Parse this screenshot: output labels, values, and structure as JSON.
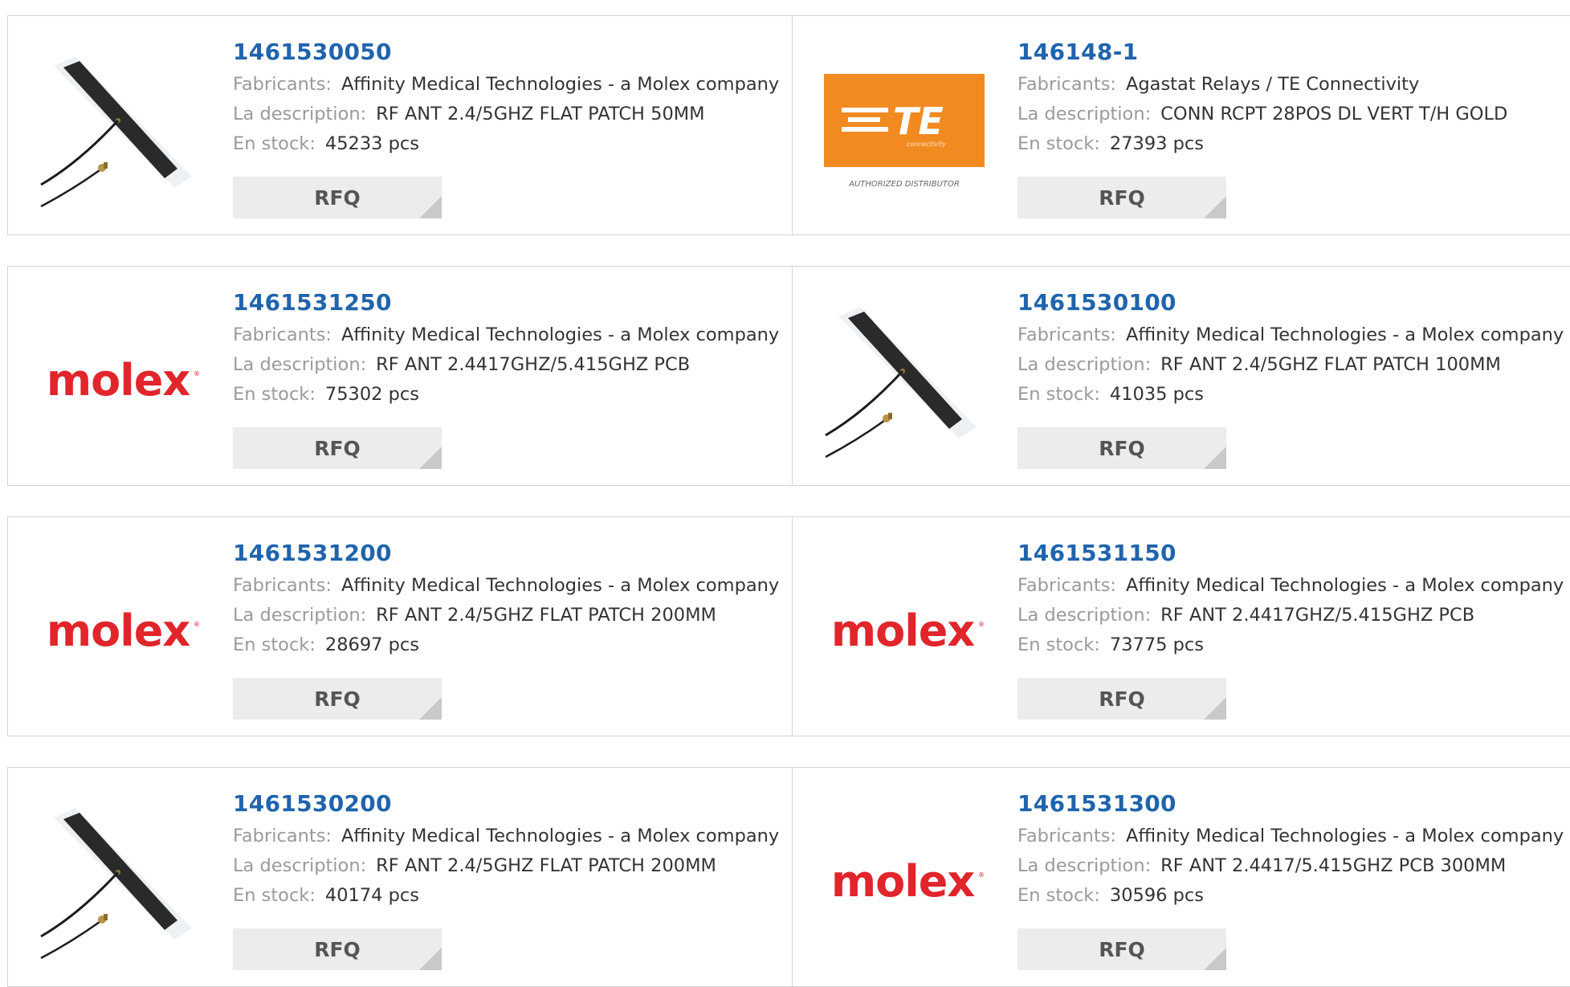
{
  "labels": {
    "manufacturer": "Fabricants:",
    "description": "La description:",
    "stock": "En stock:",
    "rfq": "RFQ"
  },
  "brands": {
    "te_wordmark": "TE",
    "te_sub": "connectivity",
    "te_tagline": "AUTHORIZED DISTRIBUTOR",
    "molex": "molex"
  },
  "colors": {
    "part_link": "#1f64ad",
    "molex_red": "#e0252b",
    "te_orange": "#f18a21"
  },
  "products": [
    {
      "part": "1461530050",
      "manufacturer": "Affinity Medical Technologies - a Molex company",
      "description": "RF ANT 2.4/5GHZ FLAT PATCH 50MM",
      "stock": "45233 pcs",
      "image": "antenna"
    },
    {
      "part": "146148-1",
      "manufacturer": "Agastat Relays / TE Connectivity",
      "description": "CONN RCPT 28POS DL VERT T/H GOLD",
      "stock": "27393 pcs",
      "image": "te"
    },
    {
      "part": "1461531250",
      "manufacturer": "Affinity Medical Technologies - a Molex company",
      "description": "RF ANT 2.4417GHZ/5.415GHZ PCB",
      "stock": "75302 pcs",
      "image": "molex"
    },
    {
      "part": "1461530100",
      "manufacturer": "Affinity Medical Technologies - a Molex company",
      "description": "RF ANT 2.4/5GHZ FLAT PATCH 100MM",
      "stock": "41035 pcs",
      "image": "antenna"
    },
    {
      "part": "1461531200",
      "manufacturer": "Affinity Medical Technologies - a Molex company",
      "description": "RF ANT 2.4/5GHZ FLAT PATCH 200MM",
      "stock": "28697 pcs",
      "image": "molex"
    },
    {
      "part": "1461531150",
      "manufacturer": "Affinity Medical Technologies - a Molex company",
      "description": "RF ANT 2.4417GHZ/5.415GHZ PCB",
      "stock": "73775 pcs",
      "image": "molex"
    },
    {
      "part": "1461530200",
      "manufacturer": "Affinity Medical Technologies - a Molex company",
      "description": "RF ANT 2.4/5GHZ FLAT PATCH 200MM",
      "stock": "40174 pcs",
      "image": "antenna"
    },
    {
      "part": "1461531300",
      "manufacturer": "Affinity Medical Technologies - a Molex company",
      "description": "RF ANT 2.4417/5.415GHZ PCB 300MM",
      "stock": "30596 pcs",
      "image": "molex"
    }
  ]
}
